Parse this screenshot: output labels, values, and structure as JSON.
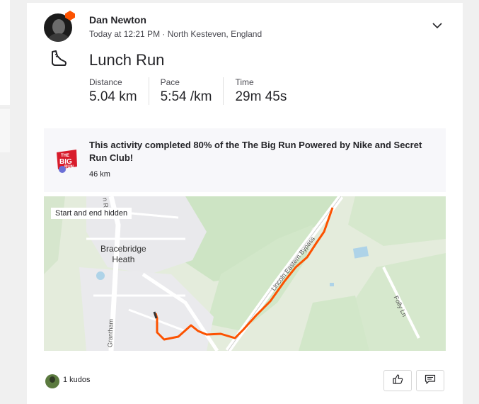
{
  "post": {
    "athlete_name": "Dan Newton",
    "meta": "Today at 12:21 PM · North Kesteven, England",
    "activity_type_icon": "shoe-icon",
    "title": "Lunch Run",
    "stats": [
      {
        "label": "Distance",
        "value": "5.04 km"
      },
      {
        "label": "Pace",
        "value": "5:54 /km"
      },
      {
        "label": "Time",
        "value": "29m 45s"
      }
    ]
  },
  "challenge": {
    "text": "This activity completed 80% of the The Big Run Powered by Nike and Secret Run Club!",
    "distance": "46 km",
    "logo_text": "THE BIG RUN"
  },
  "map": {
    "privacy_label": "Start and end hidden",
    "place_label_line1": "Bracebridge",
    "place_label_line2": "Heath",
    "road_label_1": "Lincoln Eastern Bypass",
    "road_label_2": "Folly Ln",
    "road_label_3": "Grantham",
    "road_label_4": "n R"
  },
  "footer": {
    "kudos_label": "1 kudos"
  },
  "colors": {
    "brand": "#fc5200",
    "route": "#fc5200",
    "text": "#242428"
  }
}
